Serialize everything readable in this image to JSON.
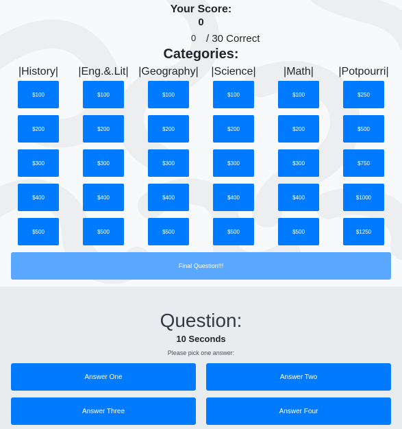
{
  "score": {
    "label": "Your Score:",
    "value": "0",
    "correct_count": "0",
    "correct_suffix": "/ 30 Correct"
  },
  "categories_title": "Categories:",
  "categories": [
    {
      "name": "|History|",
      "values": [
        "$100",
        "$200",
        "$300",
        "$400",
        "$500"
      ]
    },
    {
      "name": "|Eng.&.Lit|",
      "values": [
        "$100",
        "$200",
        "$300",
        "$400",
        "$500"
      ]
    },
    {
      "name": "|Geography|",
      "values": [
        "$100",
        "$200",
        "$300",
        "$400",
        "$500"
      ]
    },
    {
      "name": "|Science|",
      "values": [
        "$100",
        "$200",
        "$300",
        "$400",
        "$500"
      ]
    },
    {
      "name": "|Math|",
      "values": [
        "$100",
        "$200",
        "$300",
        "$400",
        "$500"
      ]
    },
    {
      "name": "|Potpourri|",
      "values": [
        "$250",
        "$500",
        "$750",
        "$1000",
        "$1250"
      ]
    }
  ],
  "final_button": "Final Question!!!",
  "question": {
    "title": "Question:",
    "timer": "10 Seconds",
    "prompt": "Please pick one answer:",
    "answers": [
      "Answer One",
      "Answer Two",
      "Answer Three",
      "Answer Four"
    ]
  },
  "colors": {
    "primary": "#007bff",
    "final": "#5aa7ff",
    "page": "#e9ecef"
  }
}
